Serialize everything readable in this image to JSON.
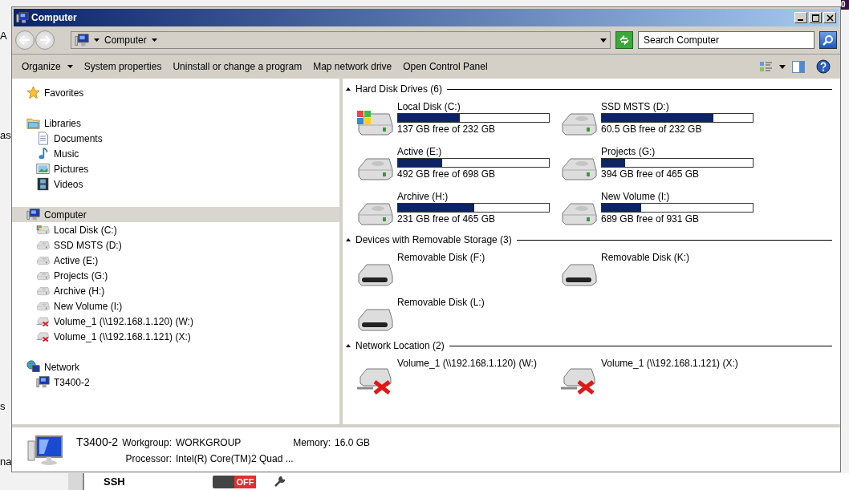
{
  "backdrop": {
    "fragments": [
      "A",
      "as",
      "s",
      "na"
    ],
    "badge": "0",
    "setting": {
      "label": "SSH",
      "on": false,
      "state_text": "OFF"
    }
  },
  "window": {
    "title": "Computer"
  },
  "address": {
    "path": "Computer"
  },
  "search": {
    "placeholder": "Search Computer"
  },
  "toolbar": [
    {
      "label": "Organize",
      "menu": true
    },
    {
      "label": "System properties",
      "menu": false
    },
    {
      "label": "Uninstall or change a program",
      "menu": false
    },
    {
      "label": "Map network drive",
      "menu": false
    },
    {
      "label": "Open Control Panel",
      "menu": false
    }
  ],
  "nav": [
    {
      "label": "Favorites",
      "kind": "star",
      "selected": false
    },
    {
      "label": "Libraries",
      "kind": "library",
      "selected": false,
      "children": [
        {
          "label": "Documents",
          "kind": "document",
          "selected": false
        },
        {
          "label": "Music",
          "kind": "music",
          "selected": false
        },
        {
          "label": "Pictures",
          "kind": "pictures",
          "selected": false
        },
        {
          "label": "Videos",
          "kind": "videos",
          "selected": false
        }
      ]
    },
    {
      "label": "Computer",
      "kind": "computer",
      "selected": true,
      "children": [
        {
          "label": "Local Disk (C:)",
          "kind": "system-drive",
          "selected": false
        },
        {
          "label": "SSD MSTS (D:)",
          "kind": "drive",
          "selected": false
        },
        {
          "label": "Active (E:)",
          "kind": "drive",
          "selected": false
        },
        {
          "label": "Projects (G:)",
          "kind": "drive",
          "selected": false
        },
        {
          "label": "Archive (H:)",
          "kind": "drive",
          "selected": false
        },
        {
          "label": "New Volume (I:)",
          "kind": "drive",
          "selected": false
        },
        {
          "label": "Volume_1 (\\\\192.168.1.120) (W:)",
          "kind": "network-drive",
          "selected": false
        },
        {
          "label": "Volume_1 (\\\\192.168.1.121) (X:)",
          "kind": "network-drive",
          "selected": false
        }
      ]
    },
    {
      "label": "Network",
      "kind": "network",
      "selected": false,
      "children": [
        {
          "label": "T3400-2",
          "kind": "computer",
          "selected": false
        }
      ]
    }
  ],
  "groups": [
    {
      "title": "Hard Disk Drives (6)",
      "expanded": true,
      "items": [
        {
          "name": "Local Disk (C:)",
          "kind": "system-drive",
          "level": 0.41,
          "free": "137 GB free of 232 GB"
        },
        {
          "name": "SSD MSTS (D:)",
          "kind": "drive",
          "level": 0.74,
          "free": "60.5 GB free of 232 GB"
        },
        {
          "name": "Active (E:)",
          "kind": "drive",
          "level": 0.295,
          "free": "492 GB free of 698 GB"
        },
        {
          "name": "Projects (G:)",
          "kind": "drive",
          "level": 0.153,
          "free": "394 GB free of 465 GB"
        },
        {
          "name": "Archive (H:)",
          "kind": "drive",
          "level": 0.503,
          "free": "231 GB free of 465 GB"
        },
        {
          "name": "New Volume (I:)",
          "kind": "drive",
          "level": 0.26,
          "free": "689 GB free of 931 GB"
        }
      ]
    },
    {
      "title": "Devices with Removable Storage (3)",
      "expanded": true,
      "items": [
        {
          "name": "Removable Disk (F:)",
          "kind": "removable"
        },
        {
          "name": "Removable Disk (K:)",
          "kind": "removable"
        },
        {
          "name": "Removable Disk (L:)",
          "kind": "removable"
        }
      ]
    },
    {
      "title": "Network Location (2)",
      "expanded": true,
      "items": [
        {
          "name": "Volume_1 (\\\\192.168.1.120) (W:)",
          "kind": "network-drive"
        },
        {
          "name": "Volume_1 (\\\\192.168.1.121) (X:)",
          "kind": "network-drive"
        }
      ]
    }
  ],
  "details": {
    "name": "T3400-2",
    "fields": [
      {
        "label": "Workgroup:",
        "value": "WORKGROUP"
      },
      {
        "label": "Memory:",
        "value": "16.0 GB"
      },
      {
        "label": "Processor:",
        "value": "Intel(R) Core(TM)2 Quad ..."
      }
    ]
  }
}
